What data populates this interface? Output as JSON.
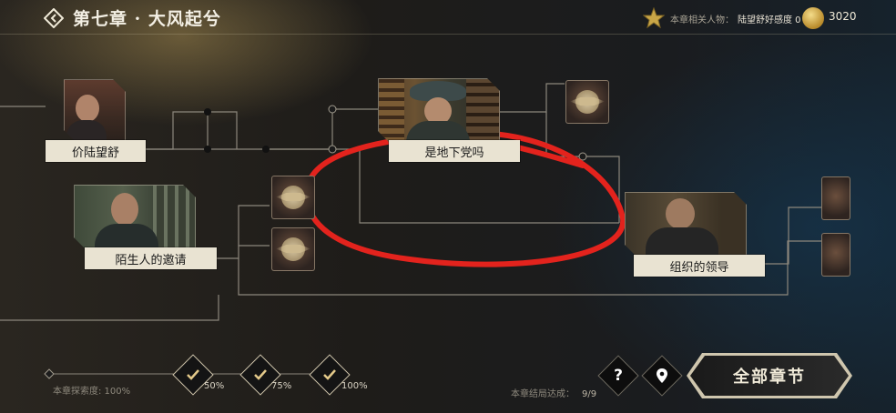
{
  "header": {
    "chapter_title": "第七章 · 大风起兮",
    "related_label": "本章相关人物：",
    "related_value": "陆望舒好感度 0",
    "coins": "3020"
  },
  "nodes": {
    "price": "价陆望舒",
    "underground": "是地下党吗",
    "stranger": "陌生人的邀请",
    "organization": "组织的领导"
  },
  "footer": {
    "exploration_label": "本章探索度: 100%",
    "milestones": [
      "50%",
      "75%",
      "100%"
    ],
    "endings_label": "本章结局达成：",
    "endings_value": "9/9",
    "help_glyph": "?",
    "all_chapters": "全部章节"
  },
  "colors": {
    "annotation_red": "#e3231d",
    "label_bg": "#e9e3d2"
  }
}
